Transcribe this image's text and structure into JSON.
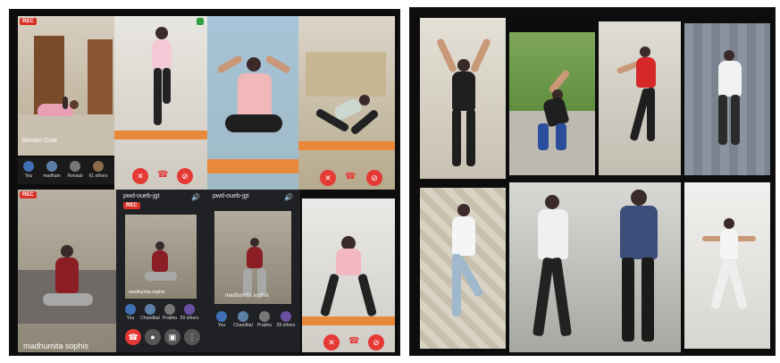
{
  "left_collage": {
    "rec_badge_1": "REC",
    "rec_badge_2": "REC",
    "rec_badge_3": "REC",
    "tile_names": {
      "top_left": "Shivani Gola",
      "bottom_left": "madhumita sophis",
      "phone_1": "madhumita sophis",
      "phone_2": "madhumita sophis"
    },
    "meeting_code_1": "pwd-oueb-jgt",
    "meeting_code_2": "pwd-oueb-jgt",
    "participant_strip": [
      {
        "label": "You"
      },
      {
        "label": "madhum"
      },
      {
        "label": "Ronauli"
      },
      {
        "label": "61 others"
      }
    ],
    "phone_strip": [
      {
        "label": "You"
      },
      {
        "label": "Chandbal"
      },
      {
        "label": "Prabha"
      },
      {
        "label": "59 others"
      }
    ],
    "phone_strip_2": [
      {
        "label": "You"
      },
      {
        "label": "Chandbal"
      },
      {
        "label": "Prabha"
      },
      {
        "label": "59 others"
      }
    ]
  },
  "colors": {
    "frame": "#0d0d0d",
    "end_call": "#e53935",
    "rec": "#d93025",
    "yoga_mat": "#e8893a"
  }
}
